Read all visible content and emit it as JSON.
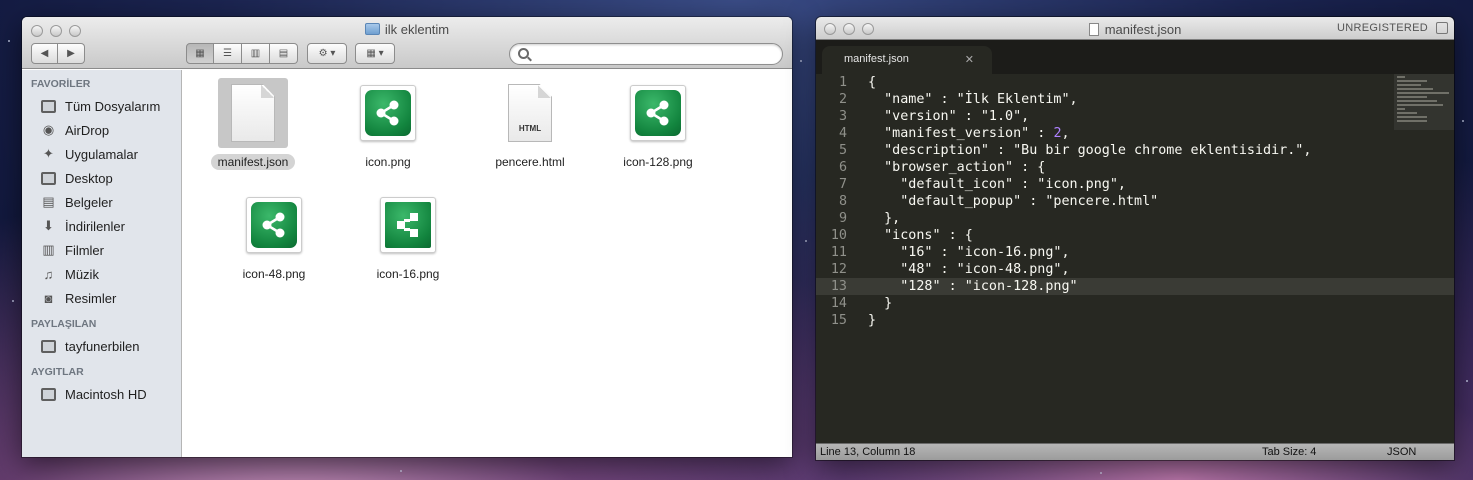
{
  "finder": {
    "title": "ilk eklentim",
    "sidebar": {
      "sections": [
        {
          "heading": "FAVORİLER",
          "items": [
            "Tüm Dosyalarım",
            "AirDrop",
            "Uygulamalar",
            "Desktop",
            "Belgeler",
            "İndirilenler",
            "Filmler",
            "Müzik",
            "Resimler"
          ]
        },
        {
          "heading": "PAYLAŞILAN",
          "items": [
            "tayfunerbilen"
          ]
        },
        {
          "heading": "AYGITLAR",
          "items": [
            "Macintosh HD"
          ]
        }
      ]
    },
    "files": [
      {
        "name": "manifest.json",
        "kind": "document",
        "selected": true
      },
      {
        "name": "icon.png",
        "kind": "share-png"
      },
      {
        "name": "pencere.html",
        "kind": "html",
        "tag": "HTML"
      },
      {
        "name": "icon-128.png",
        "kind": "share-png"
      },
      {
        "name": "icon-48.png",
        "kind": "share-png"
      },
      {
        "name": "icon-16.png",
        "kind": "share-png"
      }
    ]
  },
  "sublime": {
    "title": "manifest.json",
    "unregistered": "UNREGISTERED",
    "tab": "manifest.json",
    "current_line": 13,
    "lines": [
      "{",
      "  \"name\" : \"İlk Eklentim\",",
      "  \"version\" : \"1.0\",",
      "  \"manifest_version\" : 2,",
      "  \"description\" : \"Bu bir google chrome eklentisidir.\",",
      "  \"browser_action\" : {",
      "    \"default_icon\" : \"icon.png\",",
      "    \"default_popup\" : \"pencere.html\"",
      "  },",
      "  \"icons\" : {",
      "    \"16\" : \"icon-16.png\",",
      "    \"48\" : \"icon-48.png\",",
      "    \"128\" : \"icon-128.png\"",
      "  }",
      "}"
    ],
    "status": {
      "position": "Line 13, Column 18",
      "tab_size": "Tab Size: 4",
      "syntax": "JSON"
    }
  }
}
